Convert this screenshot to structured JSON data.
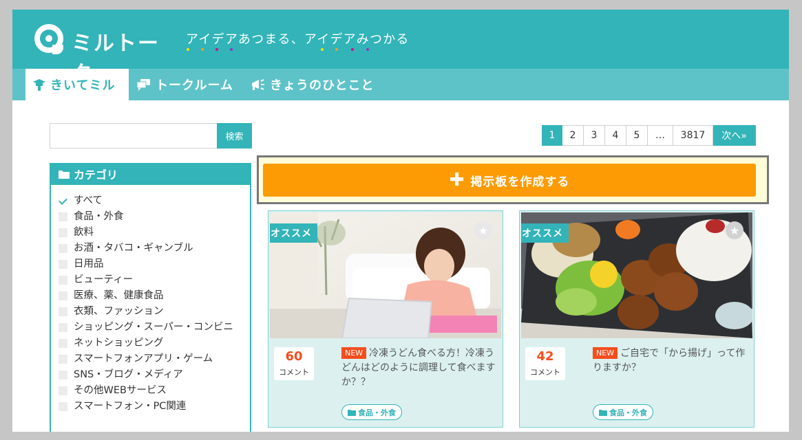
{
  "header": {
    "logo_text": "ミルトーク",
    "tagline": "アイデアあつまる、アイデアみつかる"
  },
  "nav": {
    "tabs": [
      {
        "label": "きいてミル",
        "active": true,
        "icon": "mortarboard-icon"
      },
      {
        "label": "トークルーム",
        "active": false,
        "icon": "chat-bubbles-icon"
      },
      {
        "label": "きょうのひとこと",
        "active": false,
        "icon": "megaphone-icon"
      }
    ]
  },
  "search": {
    "value": "",
    "button": "検索"
  },
  "pagination": {
    "pages": [
      "1",
      "2",
      "3",
      "4",
      "5",
      "…",
      "3817"
    ],
    "current": "1",
    "next": "次へ»"
  },
  "create_button": {
    "label": "掲示板を作成する"
  },
  "category": {
    "title": "カテゴリ",
    "items": [
      {
        "label": "すべて",
        "checked": true
      },
      {
        "label": "食品・外食",
        "checked": false
      },
      {
        "label": "飲料",
        "checked": false
      },
      {
        "label": "お酒・タバコ・ギャンブル",
        "checked": false
      },
      {
        "label": "日用品",
        "checked": false
      },
      {
        "label": "ビューティー",
        "checked": false
      },
      {
        "label": "医療、薬、健康食品",
        "checked": false
      },
      {
        "label": "衣類、ファッション",
        "checked": false
      },
      {
        "label": "ショッピング・スーパー・コンビニ",
        "checked": false
      },
      {
        "label": "ネットショッピング",
        "checked": false
      },
      {
        "label": "スマートフォンアプリ・ゲーム",
        "checked": false
      },
      {
        "label": "SNS・ブログ・メディア",
        "checked": false
      },
      {
        "label": "その他WEBサービス",
        "checked": false
      },
      {
        "label": "スマートフォン・PC関連",
        "checked": false
      }
    ]
  },
  "cards": [
    {
      "badge": "オススメ",
      "count": "60",
      "count_label": "コメント",
      "new_label": "NEW",
      "title": "冷凍うどん食べる方！冷凍うどんはどのように調理して食べますか？？",
      "tag": "食品・外食"
    },
    {
      "badge": "オススメ",
      "count": "42",
      "count_label": "コメント",
      "new_label": "NEW",
      "title": "ご自宅で「から揚げ」って作りますか？",
      "tag": "食品・外食"
    }
  ],
  "colors": {
    "brand": "#32b4b8",
    "brand_light": "#5ec3c8",
    "accent": "#fd9b04",
    "alert": "#f64d1d",
    "card_bg": "#dcf0f0"
  }
}
